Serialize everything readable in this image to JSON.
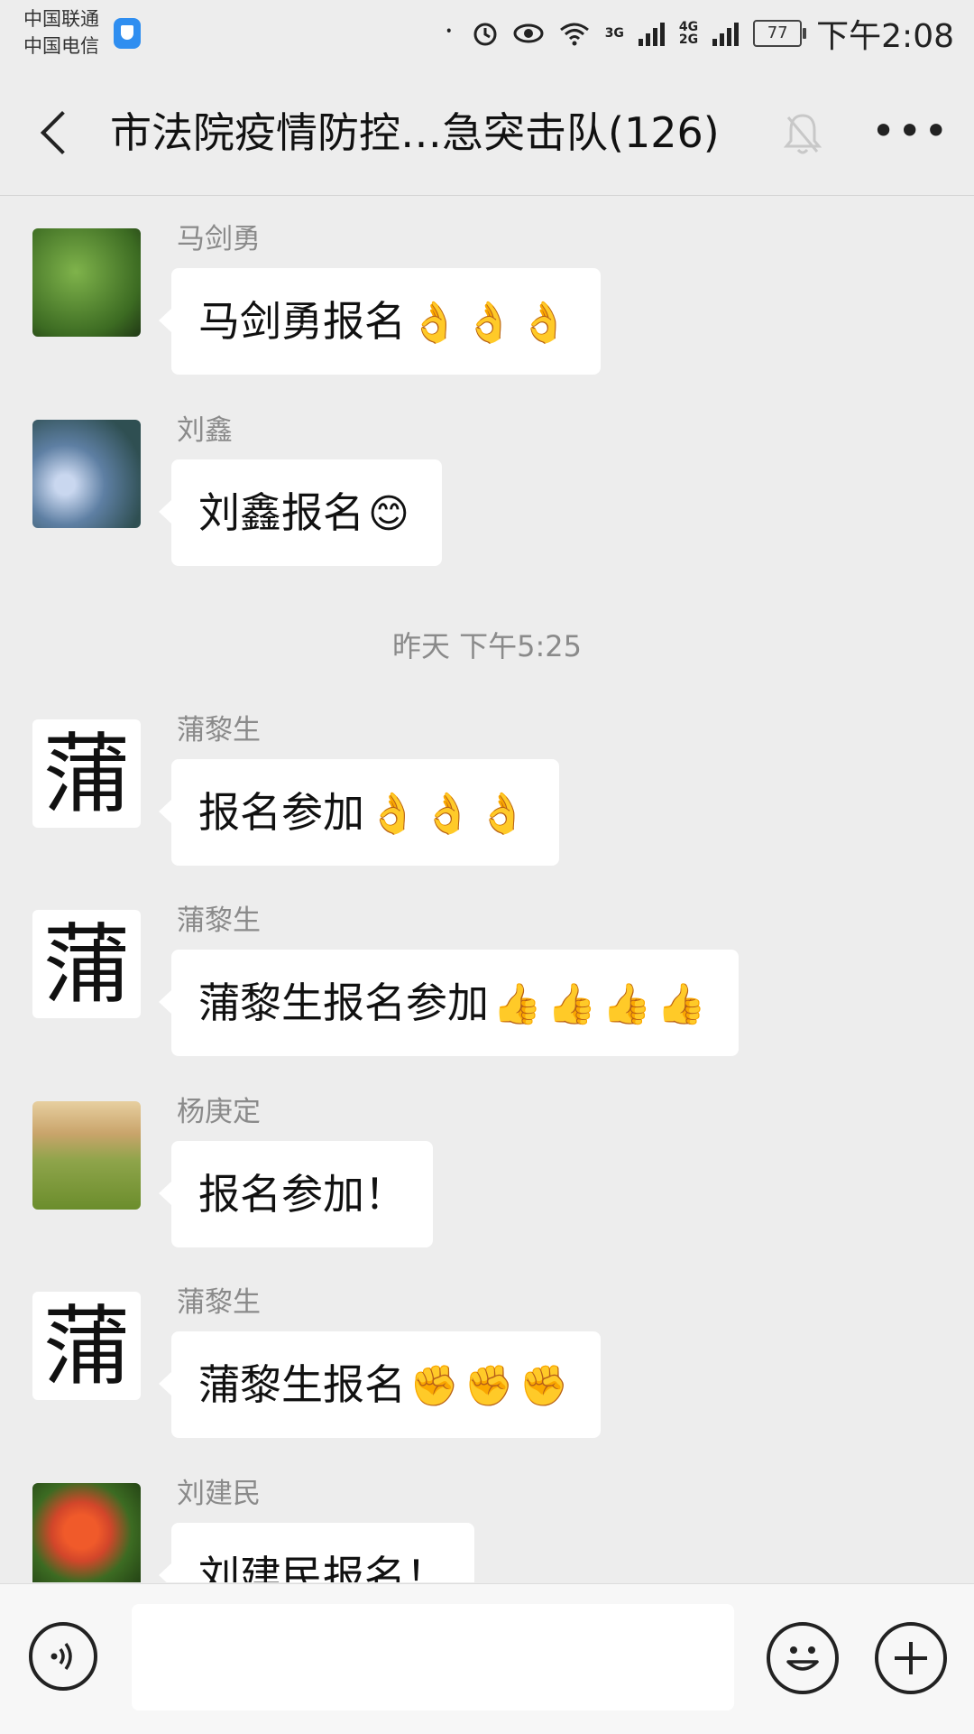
{
  "status_bar": {
    "carrier_1": "中国联通",
    "carrier_2": "中国电信",
    "network_3g": "3G",
    "network_4g": "4G",
    "network_2g": "2G",
    "battery": "77",
    "time": "下午2:08"
  },
  "header": {
    "title": "市法院疫情防控…急突击队(126)",
    "icons": [
      "back-icon",
      "mute-bell-icon",
      "more-icon"
    ]
  },
  "messages": [
    {
      "sender": "马剑勇",
      "text": "马剑勇报名",
      "emoji": "👌👌👌"
    },
    {
      "sender": "刘鑫",
      "text": "刘鑫报名",
      "emoji": "😊"
    },
    {
      "sender": "蒲黎生",
      "text": "报名参加",
      "emoji": "👌👌👌"
    },
    {
      "sender": "蒲黎生",
      "text": "蒲黎生报名参加",
      "emoji": "👍👍👍👍"
    },
    {
      "sender": "杨庚定",
      "text": "报名参加！",
      "emoji": ""
    },
    {
      "sender": "蒲黎生",
      "text": "蒲黎生报名",
      "emoji": "✊✊✊"
    },
    {
      "sender": "刘建民",
      "text": "刘建民报名！",
      "emoji": ""
    }
  ],
  "time_separator": "昨天 下午5:25",
  "avatar_glyph": "蒲",
  "input_bar": {
    "icons": [
      "voice-icon",
      "emoji-icon",
      "plus-icon"
    ],
    "placeholder": ""
  }
}
